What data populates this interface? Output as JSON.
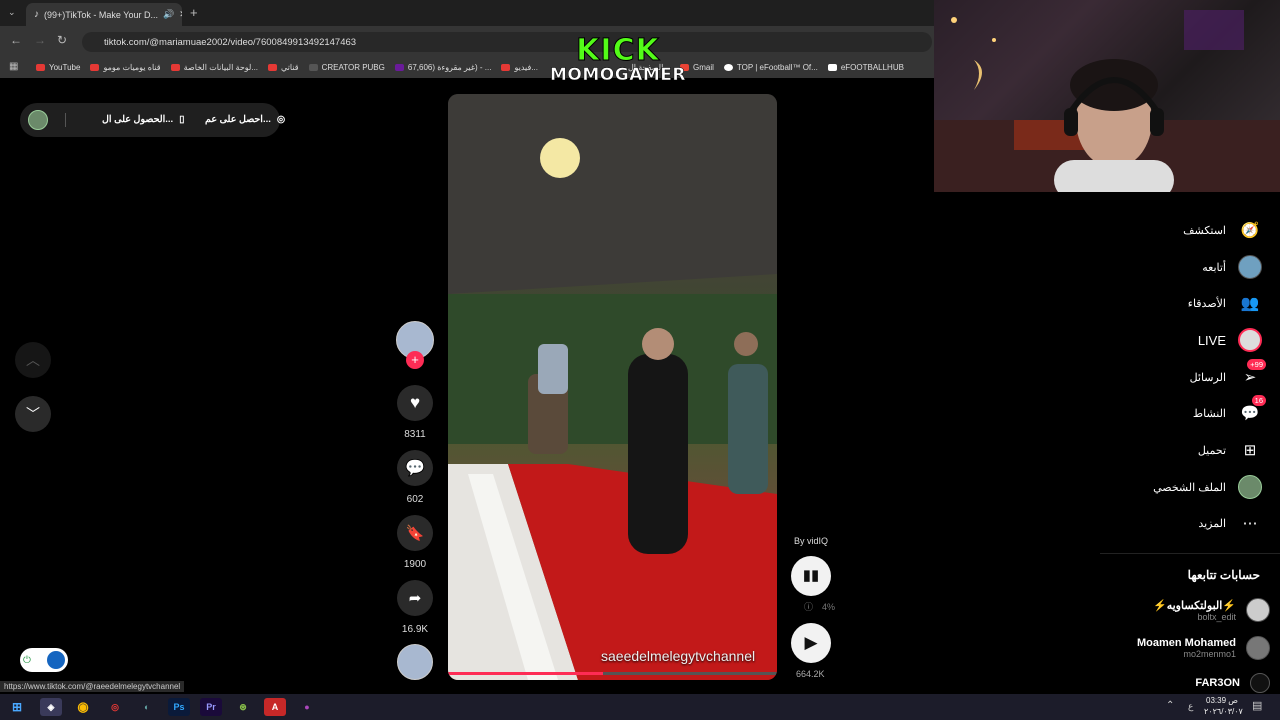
{
  "browser": {
    "tab_title": "(99+)TikTok - Make Your D...",
    "url": "tiktok.com/@mariamuae2002/video/7600849913492147463",
    "bookmarks": [
      "YouTube",
      "قناه يوميات مومو",
      "لوحة البيانات الخاصة...",
      "قناتي",
      "CREATOR PUBG",
      "67,606) غير مقروءة) - ...",
      "فيديو...",
      "الصفحة ال...",
      "Gmail",
      "TOP | eFootball™ Of...",
      "eFOOTBALLHUB"
    ]
  },
  "overlay": {
    "kick_line1": "KICK",
    "kick_line2": "MOMOGAMER"
  },
  "top_pill": {
    "item1": "احصل على عم...",
    "item2": "الحصول على ال..."
  },
  "video": {
    "watermark": "saeedelmelegytvchannel"
  },
  "actions": {
    "likes": "8311",
    "comments": "602",
    "saves": "1900",
    "shares": "16.9K"
  },
  "vidiq": {
    "by_label": "By vidIQ",
    "percent": "4%",
    "views": "664.2K"
  },
  "sidebar": {
    "items": [
      {
        "label": "استكشف",
        "icon": "compass-icon"
      },
      {
        "label": "أتابعه",
        "icon": "avatar"
      },
      {
        "label": "الأصدقاء",
        "icon": "friends-icon"
      },
      {
        "label": "LIVE",
        "icon": "live-avatar"
      },
      {
        "label": "الرسائل",
        "icon": "send-icon",
        "badge": "+99"
      },
      {
        "label": "النشاط",
        "icon": "inbox-icon",
        "badge": "16"
      },
      {
        "label": "تحميل",
        "icon": "plus-square-icon"
      },
      {
        "label": "الملف الشخصي",
        "icon": "profile-avatar"
      },
      {
        "label": "المزيد",
        "icon": "more-icon"
      }
    ],
    "following_title": "حسابات تتابعها",
    "following": [
      {
        "name": "⚡البولتكساويه⚡",
        "handle": "boltx_edit"
      },
      {
        "name": "Moamen Mohamed",
        "handle": "mo2menmo1"
      },
      {
        "name": "FAR3ON",
        "handle": ""
      }
    ]
  },
  "status_link": "https://www.tiktok.com/@raeedelmelegytvchannel",
  "taskbar": {
    "time": "03:39 ص",
    "date": "٢٠٢٦/٠٣/٠٧",
    "lang": "ع"
  },
  "colors": {
    "accent": "#fe2c55",
    "kick_green": "#53fc18"
  }
}
